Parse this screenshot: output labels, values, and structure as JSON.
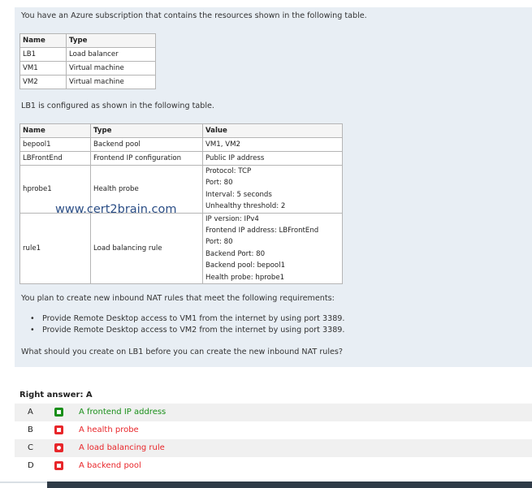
{
  "question": {
    "intro": "You have an Azure subscription that contains the resources shown in the following table.",
    "table1": {
      "headers": [
        "Name",
        "Type"
      ],
      "rows": [
        [
          "LB1",
          "Load balancer"
        ],
        [
          "VM1",
          "Virtual machine"
        ],
        [
          "VM2",
          "Virtual machine"
        ]
      ]
    },
    "lb_intro": "LB1 is configured as shown in the following table.",
    "table2": {
      "headers": [
        "Name",
        "Type",
        "Value"
      ],
      "rows": [
        {
          "name": "bepool1",
          "type": "Backend pool",
          "value": [
            "VM1, VM2"
          ]
        },
        {
          "name": "LBFrontEnd",
          "type": "Frontend IP configuration",
          "value": [
            "Public IP address"
          ]
        },
        {
          "name": "hprobe1",
          "type": "Health probe",
          "value": [
            "Protocol: TCP",
            "Port: 80",
            "Interval: 5 seconds",
            "Unhealthy threshold: 2"
          ]
        },
        {
          "name": "rule1",
          "type": "Load balancing rule",
          "value": [
            "IP version: IPv4",
            "Frontend IP address: LBFrontEnd",
            "Port: 80",
            "Backend Port: 80",
            "Backend pool: bepool1",
            "Health probe: hprobe1"
          ]
        }
      ]
    },
    "watermark": "www.cert2brain.com",
    "plan_text": "You plan to create new inbound NAT rules that meet the following requirements:",
    "requirements": [
      "Provide Remote Desktop access to VM1 from the internet by using port 3389.",
      "Provide Remote Desktop access to VM2 from the internet by using port 3389."
    ],
    "prompt": "What should you create on LB1 before you can create the new inbound NAT rules?"
  },
  "answer": {
    "title": "Right answer: A",
    "options": [
      {
        "letter": "A",
        "text": "A frontend IP address",
        "status": "correct",
        "color": "#1a8f1a"
      },
      {
        "letter": "B",
        "text": "A health probe",
        "status": "incorrect",
        "color": "#e8262a"
      },
      {
        "letter": "C",
        "text": "A load balancing rule",
        "status": "selected-incorrect",
        "color": "#e8262a"
      },
      {
        "letter": "D",
        "text": "A backend pool",
        "status": "incorrect",
        "color": "#e8262a"
      }
    ]
  }
}
